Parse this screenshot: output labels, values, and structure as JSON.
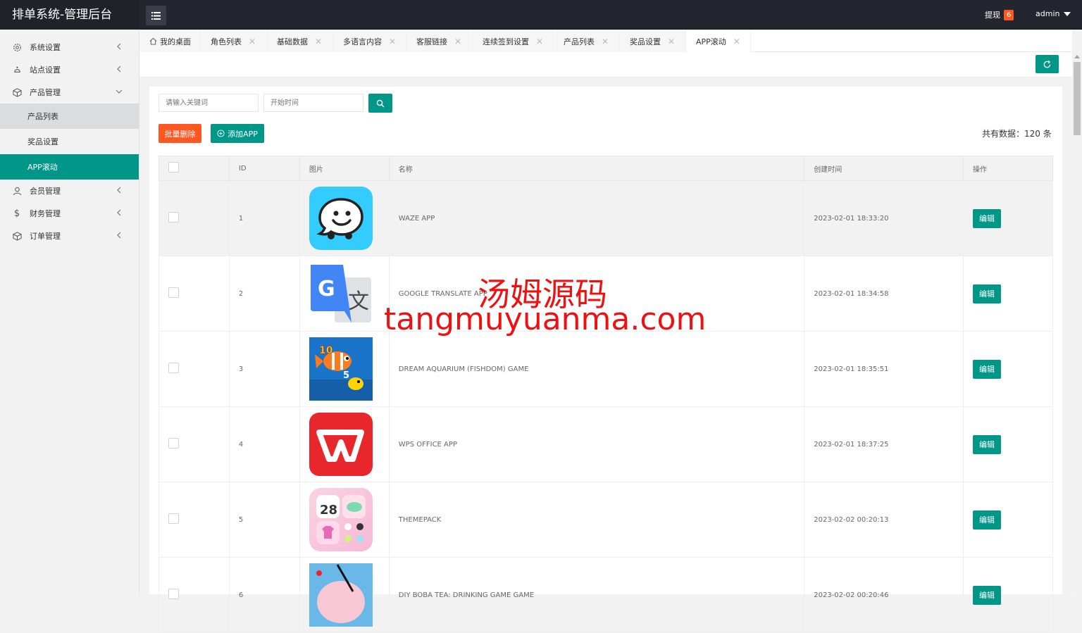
{
  "header": {
    "brand": "排单系统-管理后台",
    "withdraw_label": "提现",
    "withdraw_count": "6",
    "user_name": "admin"
  },
  "sidebar": {
    "items": [
      {
        "label": "系统设置",
        "icon": "gear-icon"
      },
      {
        "label": "站点设置",
        "icon": "site-icon"
      },
      {
        "label": "产品管理",
        "icon": "cube-icon"
      },
      {
        "label": "会员管理",
        "icon": "user-icon"
      },
      {
        "label": "财务管理",
        "icon": "dollar-icon"
      },
      {
        "label": "订单管理",
        "icon": "cube-icon"
      }
    ],
    "sub_items": [
      {
        "label": "产品列表"
      },
      {
        "label": "奖品设置"
      },
      {
        "label": "APP滚动"
      }
    ]
  },
  "tabs": [
    {
      "label": "我的桌面"
    },
    {
      "label": "角色列表"
    },
    {
      "label": "基础数据"
    },
    {
      "label": "多语言内容"
    },
    {
      "label": "客服链接"
    },
    {
      "label": "连续签到设置"
    },
    {
      "label": "产品列表"
    },
    {
      "label": "奖品设置"
    },
    {
      "label": "APP滚动"
    }
  ],
  "search": {
    "keyword_placeholder": "请输入关键词",
    "date_placeholder": "开始时间"
  },
  "toolbar": {
    "batch_delete": "批量删除",
    "add_app": "添加APP",
    "total": "共有数据：120 条"
  },
  "table": {
    "columns": [
      "ID",
      "图片",
      "名称",
      "创建时间",
      "操作"
    ],
    "edit_label": "编辑",
    "rows": [
      {
        "id": "1",
        "name": "WAZE APP",
        "created": "2023-02-01 18:33:20",
        "image": "waze-icon"
      },
      {
        "id": "2",
        "name": "GOOGLE TRANSLATE APP",
        "created": "2023-02-01 18:34:58",
        "image": "google-translate-icon"
      },
      {
        "id": "3",
        "name": "DREAM AQUARIUM (FISHDOM) GAME",
        "created": "2023-02-01 18:35:51",
        "image": "fishdom-icon"
      },
      {
        "id": "4",
        "name": "WPS OFFICE APP",
        "created": "2023-02-01 18:37:25",
        "image": "wps-icon"
      },
      {
        "id": "5",
        "name": "THEMEPACK",
        "created": "2023-02-02 00:20:13",
        "image": "themepack-icon"
      },
      {
        "id": "6",
        "name": "DIY BOBA TEA: DRINKING GAME GAME",
        "created": "2023-02-02 00:20:46",
        "image": "boba-tea-icon"
      }
    ]
  },
  "watermark": {
    "line1": "汤姆源码",
    "line2": "tangmuyuanma.com"
  },
  "colors": {
    "accent": "#009688",
    "danger": "#ff5722",
    "header": "#23262e"
  }
}
